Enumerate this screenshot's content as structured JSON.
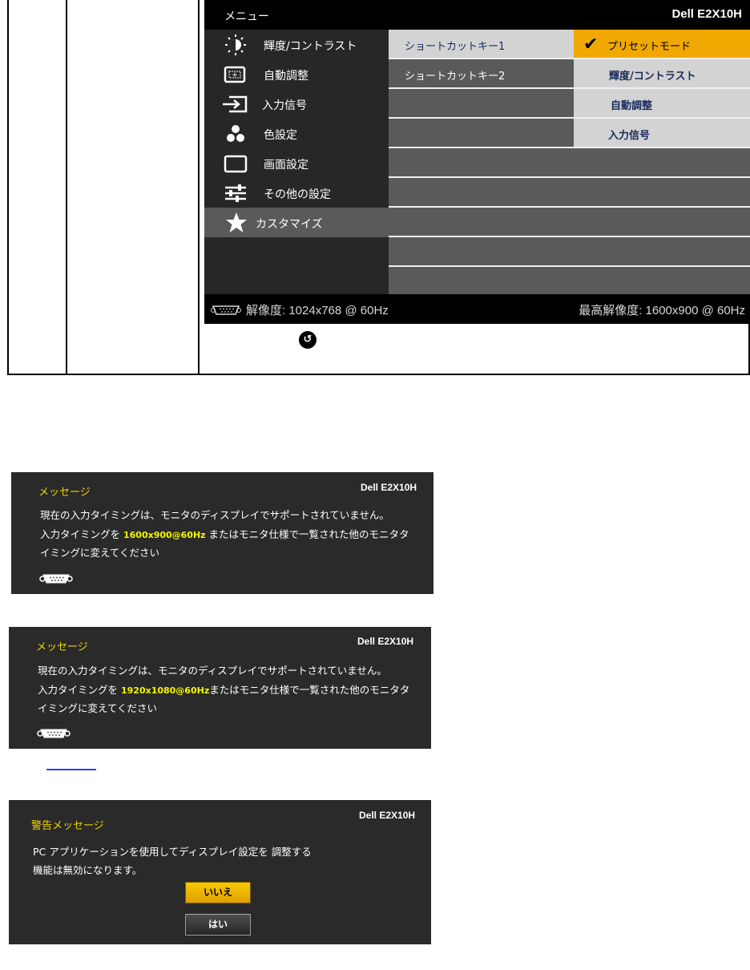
{
  "osd": {
    "title": "メニュー",
    "model": "Dell E2X10H",
    "menu": [
      {
        "label": "輝度/コントラスト",
        "icon": "brightness-icon"
      },
      {
        "label": "自動調整",
        "icon": "auto-adjust-icon"
      },
      {
        "label": "入力信号",
        "icon": "input-source-icon"
      },
      {
        "label": "色設定",
        "icon": "color-settings-icon"
      },
      {
        "label": "画面設定",
        "icon": "display-settings-icon"
      },
      {
        "label": "その他の設定",
        "icon": "other-settings-icon"
      },
      {
        "label": "カスタマイズ",
        "icon": "star-icon",
        "selected": true
      }
    ],
    "shortcuts": [
      {
        "label": "ショートカットキー1"
      },
      {
        "label": "ショートカットキー2"
      }
    ],
    "options": [
      {
        "label": "プリセットモード",
        "checked": true
      },
      {
        "label": "輝度/コントラスト"
      },
      {
        "label": "自動調整"
      },
      {
        "label": "入力信号"
      }
    ],
    "footer_left": "解像度: 1024x768 @ 60Hz",
    "footer_right": "最高解像度: 1600x900 @ 60Hz"
  },
  "messages": [
    {
      "title": "メッセージ",
      "model": "Dell E2X10H",
      "line1": "現在の入力タイミングは、モニタのディスプレイでサポートされていません。",
      "line2_pre": "入力タイミングを ",
      "line2_hl": "1600x900@60Hz",
      "line2_post": " またはモニタ仕様で一覧された他のモニタタ",
      "line3": "イミングに変えてください"
    },
    {
      "title": "メッセージ",
      "model": "Dell E2X10H",
      "line1": "現在の入力タイミングは、モニタのディスプレイでサポートされていません。",
      "line2_pre": "入力タイミングを ",
      "line2_hl": "1920x1080@60Hz",
      "line2_post": "またはモニタ仕様で一覧された他のモニタタ",
      "line3": "イミングに変えてください"
    }
  ],
  "warning": {
    "title": "警告メッセージ",
    "model": "Dell E2X10H",
    "line1": "PC アプリケーションを使用してディスプレイ設定を 調整する",
    "line2": "機能は無効になります。",
    "no_label": "いいえ",
    "yes_label": "はい"
  }
}
